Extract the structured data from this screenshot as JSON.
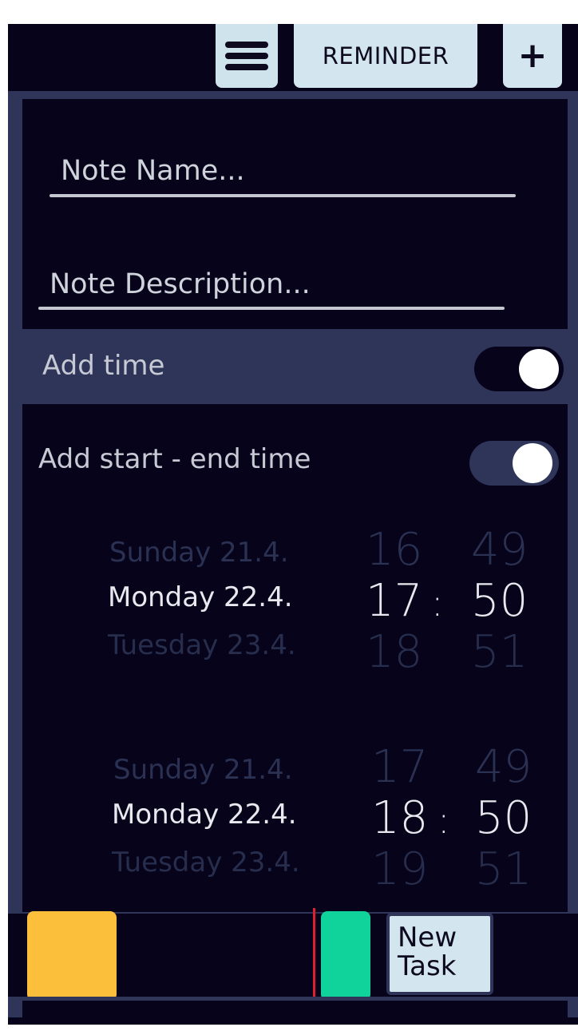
{
  "toolbar": {
    "menu_icon": "hamburger-menu-icon",
    "reminder_label": "REMINDER",
    "add_label": "+"
  },
  "form": {
    "note_name_placeholder": "Note Name...",
    "note_description_placeholder": "Note Description..."
  },
  "toggles": {
    "add_time": {
      "label": "Add time",
      "on": true
    },
    "add_start_end": {
      "label": "Add start - end time",
      "on": true
    }
  },
  "start_picker": {
    "days": [
      "Sunday 21.4.",
      "Monday 22.4.",
      "Tuesday 23.4."
    ],
    "hours": [
      "16",
      "17",
      "18"
    ],
    "minutes": [
      "49",
      "50",
      "51"
    ],
    "separator": ":"
  },
  "end_picker": {
    "days": [
      "Sunday 21.4.",
      "Monday 22.4.",
      "Tuesday 23.4."
    ],
    "hours": [
      "17",
      "18",
      "19"
    ],
    "minutes": [
      "49",
      "50",
      "51"
    ],
    "separator": ":"
  },
  "bottom": {
    "new_task_label": "New\nTask"
  },
  "colors": {
    "background": "#06031a",
    "band": "#2f3558",
    "button_light": "#d3e5ee",
    "swatch_yellow": "#fbbf3c",
    "swatch_green": "#0fd39a",
    "indicator_red": "#e0202c",
    "toggle_track_on_add_time": "#06031a",
    "toggle_track_on_start_end": "#2f3558"
  }
}
